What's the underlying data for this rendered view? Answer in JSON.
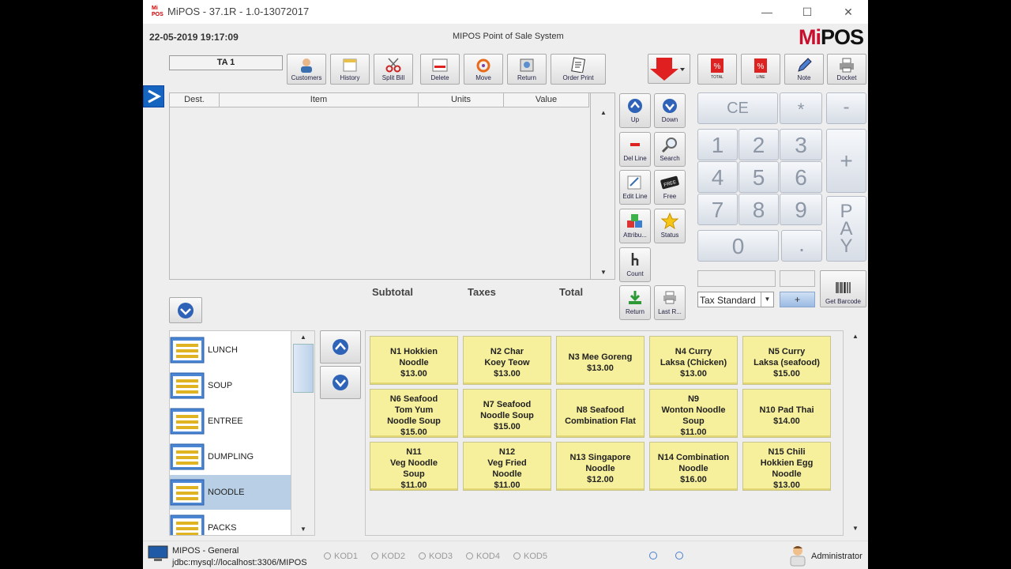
{
  "window": {
    "title": "MiPOS - 37.1R - 1.0-13072017",
    "header_date": "22-05-2019 19:17:09",
    "header_center": "MIPOS Point of Sale System",
    "logo_a": "Mi",
    "logo_b": "POS",
    "app_icon_text": "Mi POS"
  },
  "toolbar": {
    "ticket_field": "TA 1",
    "buttons": [
      {
        "label": "Customers"
      },
      {
        "label": "History"
      },
      {
        "label": "Split Bill"
      },
      {
        "label": "Delete"
      },
      {
        "label": "Move"
      },
      {
        "label": "Return"
      },
      {
        "label": "Order Print"
      }
    ],
    "right_buttons": [
      {
        "label": "",
        "icon_text": "TOTAL"
      },
      {
        "label": "",
        "icon_text": "LINE"
      },
      {
        "label": "Note"
      },
      {
        "label": "Docket"
      }
    ]
  },
  "ticket": {
    "columns": [
      "Dest.",
      "Item",
      "Units",
      "Value"
    ],
    "summary": {
      "subtotal": "Subtotal",
      "taxes": "Taxes",
      "total": "Total"
    }
  },
  "side_buttons": [
    {
      "label": "Up"
    },
    {
      "label": "Down"
    },
    {
      "label": "Del Line"
    },
    {
      "label": "Search"
    },
    {
      "label": "Edit Line"
    },
    {
      "label": "Free",
      "icon_text": "FREE"
    },
    {
      "label": "Attribu..."
    },
    {
      "label": "Status"
    },
    {
      "label": "Count"
    },
    {
      "label": "Return"
    },
    {
      "label": "Last R..."
    }
  ],
  "keypad": {
    "ce": "CE",
    "mul": "*",
    "minus": "-",
    "plus": "+",
    "digits": [
      "1",
      "2",
      "3",
      "4",
      "5",
      "6",
      "7",
      "8",
      "9"
    ],
    "zero": "0",
    "dot": ".",
    "pay": [
      "P",
      "A",
      "Y"
    ]
  },
  "tax": {
    "selected": "Tax Standard",
    "plus_btn": "+",
    "barcode_label": "Get Barcode"
  },
  "categories": [
    "LUNCH",
    "SOUP",
    "ENTREE",
    "DUMPLING",
    "NOODLE",
    "PACKS"
  ],
  "selected_category": "NOODLE",
  "products": [
    {
      "text": "N1 Hokkien\nNoodle\n$13.00"
    },
    {
      "text": "N2 Char\nKoey Teow\n$13.00"
    },
    {
      "text": "N3 Mee Goreng\n$13.00"
    },
    {
      "text": "N4 Curry\nLaksa (Chicken)\n$13.00"
    },
    {
      "text": "N5 Curry\nLaksa (seafood)\n$15.00"
    },
    {
      "text": "N6 Seafood\nTom Yum\nNoodle Soup\n$15.00"
    },
    {
      "text": "N7 Seafood\nNoodle Soup\n$15.00"
    },
    {
      "text": "N8 Seafood\nCombination Flat"
    },
    {
      "text": "N9\nWonton Noodle\nSoup\n$11.00"
    },
    {
      "text": "N10 Pad Thai\n$14.00"
    },
    {
      "text": "N11\nVeg Noodle\nSoup\n$11.00"
    },
    {
      "text": "N12\nVeg Fried\nNoodle\n$11.00"
    },
    {
      "text": "N13 Singapore\nNoodle\n$12.00"
    },
    {
      "text": "N14 Combination\nNoodle\n$16.00"
    },
    {
      "text": "N15 Chili\nHokkien Egg\nNoodle\n$13.00"
    }
  ],
  "status_bar": {
    "app": "MIPOS - General",
    "db": "jdbc:mysql://localhost:3306/MIPOS",
    "kods": [
      "KOD1",
      "KOD2",
      "KOD3",
      "KOD4",
      "KOD5"
    ],
    "user": "Administrator"
  },
  "colors": {
    "accent_red": "#c8102e",
    "product_yellow": "#f6ef9c",
    "selected_category": "#b8cfe6",
    "side_tab_blue": "#1565c0"
  }
}
